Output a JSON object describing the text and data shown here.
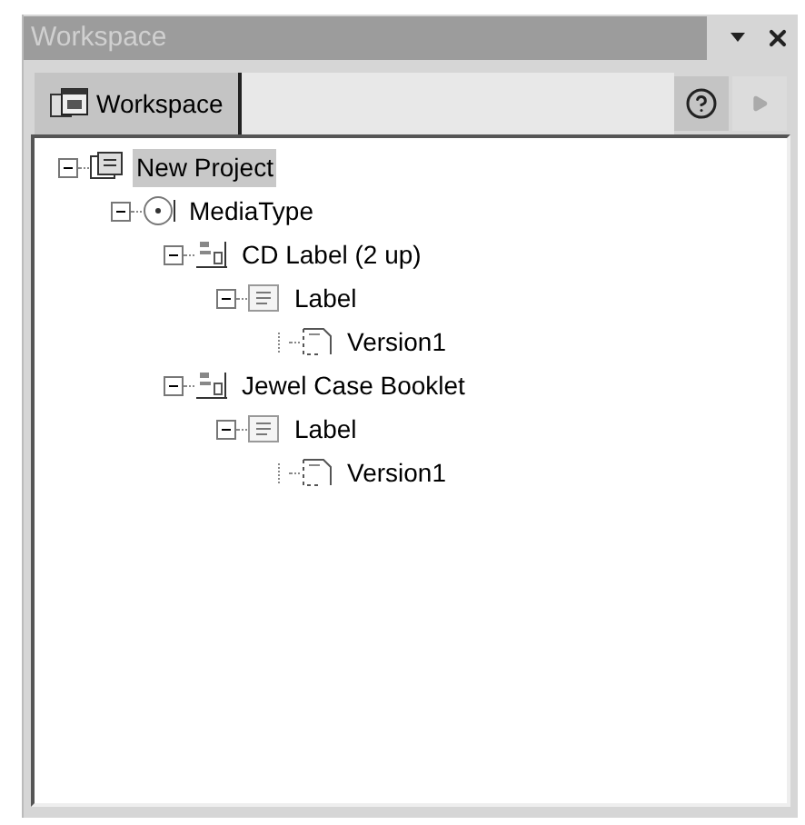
{
  "window": {
    "title": "Workspace"
  },
  "tabs": [
    {
      "label": "Workspace",
      "selected": true
    }
  ],
  "tree": [
    {
      "label": "New Project",
      "kind": "project",
      "expanded": true,
      "selected": true,
      "children": [
        {
          "label": "MediaType",
          "kind": "media",
          "expanded": true,
          "selected": false,
          "children": [
            {
              "label": "CD Label (2 up)",
              "kind": "document",
              "expanded": true,
              "selected": false,
              "children": [
                {
                  "label": "Label",
                  "kind": "label",
                  "expanded": true,
                  "selected": false,
                  "children": [
                    {
                      "label": "Version1",
                      "kind": "version",
                      "selected": false
                    }
                  ]
                }
              ]
            },
            {
              "label": "Jewel Case Booklet",
              "kind": "document",
              "expanded": true,
              "selected": false,
              "children": [
                {
                  "label": "Label",
                  "kind": "label",
                  "expanded": true,
                  "selected": false,
                  "children": [
                    {
                      "label": "Version1",
                      "kind": "version",
                      "selected": false
                    }
                  ]
                }
              ]
            }
          ]
        }
      ]
    }
  ]
}
